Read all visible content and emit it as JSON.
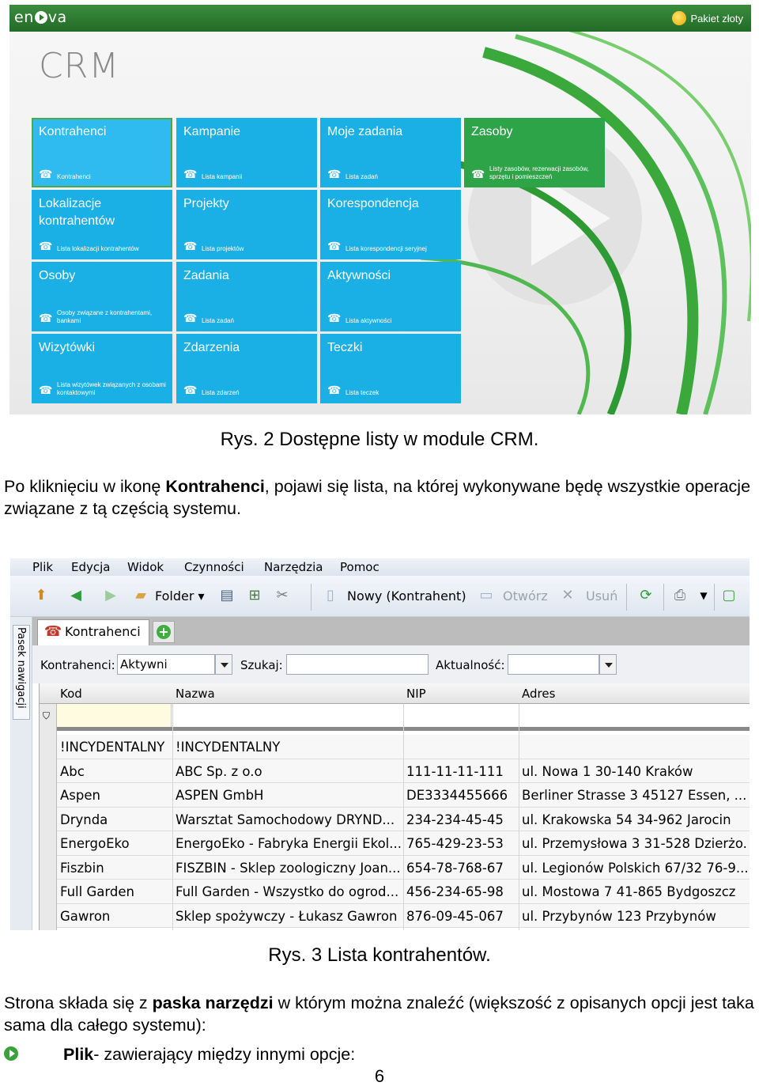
{
  "figure1": {
    "logo": "en",
    "logo_tail": "va",
    "package": "Pakiet złoty",
    "title": "CRM",
    "tiles": [
      {
        "title": "Kontrahenci",
        "sub": "Kontrahenci"
      },
      {
        "title": "Kampanie",
        "sub": "Lista kampanii"
      },
      {
        "title": "Moje zadania",
        "sub": "Lista zadań"
      },
      {
        "title": "Zasoby",
        "sub": "Listy zasobów, rezerwacji zasobów, sprzętu i pomieszczeń"
      },
      {
        "title": "Lokalizacje kontrahentów",
        "sub": "Lista lokalizacji kontrahentów"
      },
      {
        "title": "Projekty",
        "sub": "Lista projektów"
      },
      {
        "title": "Korespondencja",
        "sub": "Lista korespondencji seryjnej"
      },
      {
        "title": "Osoby",
        "sub": "Osoby związane z kontrahentami, bankami"
      },
      {
        "title": "Zadania",
        "sub": "Lista zadań"
      },
      {
        "title": "Aktywności",
        "sub": "Lista aktywności"
      },
      {
        "title": "Wizytówki",
        "sub": "Lista wizytówek związanych z osobami kontaktowymi"
      },
      {
        "title": "Zdarzenia",
        "sub": "Lista zdarzeń"
      },
      {
        "title": "Teczki",
        "sub": "Lista teczek"
      }
    ]
  },
  "caption1": "Rys. 2 Dostępne listy w module CRM.",
  "para1": {
    "before": "Po kliknięciu w ikonę ",
    "bold": "Kontrahenci",
    "after": ", pojawi się lista, na której wykonywane będę wszystkie operacje związane z tą częścią systemu."
  },
  "figure2": {
    "menu": [
      "Plik",
      "Edycja",
      "Widok",
      "Czynności",
      "Narzędzia",
      "Pomoc"
    ],
    "toolbar": {
      "folder": "Folder",
      "new": "Nowy (Kontrahent)",
      "open": "Otwórz",
      "delete": "Usuń"
    },
    "nav_strip": "Pasek nawigacji",
    "tab": "Kontrahenci",
    "tab_add": "+",
    "filter": {
      "kontrahenci_label": "Kontrahenci:",
      "kontrahenci_value": "Aktywni",
      "search_label": "Szukaj:",
      "search_value": "",
      "aktualnosc_label": "Aktualność:",
      "aktualnosc_value": ""
    },
    "columns": [
      "Kod",
      "Nazwa",
      "NIP",
      "Adres"
    ],
    "rows": [
      [
        "!INCYDENTALNY",
        "!INCYDENTALNY",
        "",
        ""
      ],
      [
        "Abc",
        "ABC Sp. z o.o",
        "111-11-11-111",
        "ul. Nowa 1 30-140 Kraków"
      ],
      [
        "Aspen",
        "ASPEN GmbH",
        "DE3334455666",
        "Berliner Strasse 3  45127 Essen, ..."
      ],
      [
        "Drynda",
        "Warsztat Samochodowy DRYND...",
        "234-234-45-45",
        "ul. Krakowska 54 34-962 Jarocin"
      ],
      [
        "EnergoEko",
        "EnergoEko - Fabryka Energii Ekol...",
        "765-429-23-53",
        "ul. Przemysłowa 3 31-528 Dzierżo..."
      ],
      [
        "Fiszbin",
        "FISZBIN - Sklep zoologiczny Joan...",
        "654-78-768-67",
        "ul. Legionów Polskich 67/32 76-9..."
      ],
      [
        "Full Garden",
        "Full Garden - Wszystko do ogrod...",
        "456-234-65-98",
        "ul. Mostowa 7 41-865 Bydgoszcz"
      ],
      [
        "Gawron",
        "Sklep spożywczy - Łukasz Gawron",
        "876-09-45-067",
        "ul. Przybynów 123  Przybynów"
      ]
    ]
  },
  "caption2": "Rys. 3 Lista kontrahentów.",
  "para2": {
    "before": "Strona składa się z ",
    "bold": "paska narzędzi",
    "after": " w którym można znaleźć (większość z opisanych opcji jest taka sama dla całego systemu):"
  },
  "bullet1": {
    "bold": "Plik",
    "after": "- zawierający między innymi opcje:"
  },
  "page_number": "6",
  "colors": {
    "tile_blue": "#1ab0e6",
    "tile_green": "#2ea449",
    "header_green": "#2a7a2e"
  }
}
